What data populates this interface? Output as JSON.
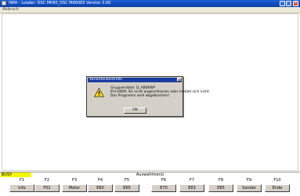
{
  "window": {
    "title": "INPA - Loader: DSC MK60_DSC MK60E5 Version 3.00",
    "menu_label": "Abbruch"
  },
  "dialog": {
    "title": "Variantenkontrolle",
    "lines": [
      "Gruppendatei: D_ABSKWP",
      "IFH-0009: SG nicht angeschlossen oder meldet sich nicht.",
      "Das Programm wird abgebrochen!"
    ],
    "ok_label": "OK",
    "icon": "warning-icon"
  },
  "status": {
    "busy_label": "BUSY",
    "menu_title": "Auswahlmenü"
  },
  "function_keys": [
    {
      "code": "F1",
      "label": "Info"
    },
    {
      "code": "F2",
      "label": "F01"
    },
    {
      "code": "F3",
      "label": "Motor"
    },
    {
      "code": "F4",
      "label": "E60"
    },
    {
      "code": "F5",
      "label": "E65"
    },
    {
      "code": "F6",
      "label": "E70"
    },
    {
      "code": "F7",
      "label": "E83"
    },
    {
      "code": "F8",
      "label": "E85"
    },
    {
      "code": "F9",
      "label": "Sonder"
    },
    {
      "code": "F10",
      "label": "Ende"
    }
  ],
  "colors": {
    "titlebar": "#0a3fa8",
    "busy": "#f5f500",
    "button_face": "#d4d0c8"
  }
}
